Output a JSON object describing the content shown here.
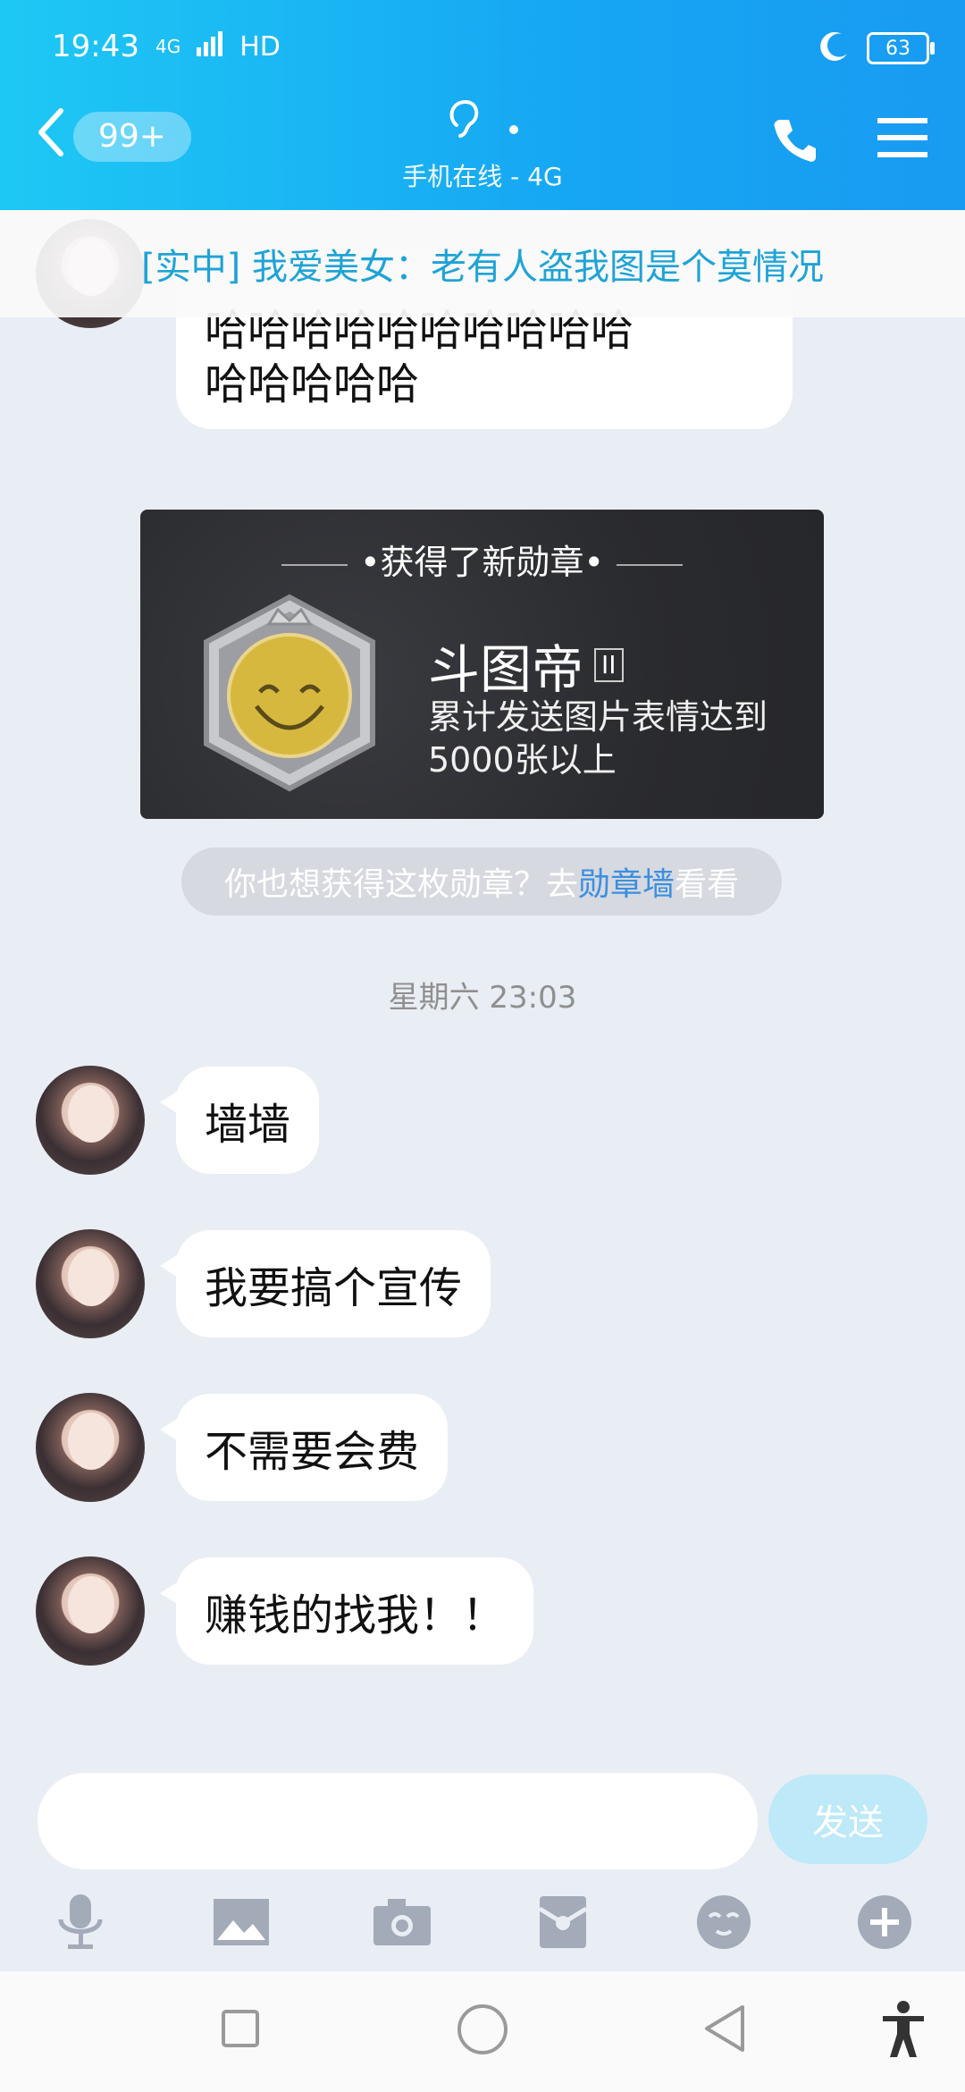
{
  "status": {
    "time": "19:43",
    "network": "4G",
    "hd": "HD",
    "battery": "63"
  },
  "header": {
    "unread": "99+",
    "sub": "手机在线 - 4G"
  },
  "notice": "[实中] 我爱美女：老有人盗我图是个莫情况",
  "first_message": {
    "line1": "哈哈哈哈哈哈哈哈哈哈哈哈哈哈哈哈哈哈哈哈",
    "line2": "哈哈哈哈哈哈哈哈哈哈",
    "line3": "哈哈哈哈哈"
  },
  "medal": {
    "heading": "获得了新勋章",
    "name": "斗图帝",
    "tier": "II",
    "desc": "累计发送图片表情达到5000张以上",
    "prompt_before": "你也想获得这枚勋章？去",
    "prompt_link": "勋章墙",
    "prompt_after": "看看"
  },
  "timestamp": "星期六 23:03",
  "messages": [
    "墙墙",
    "我要搞个宣传",
    "不需要会费",
    "赚钱的找我！！"
  ],
  "input": {
    "send": "发送",
    "placeholder": ""
  },
  "colors": {
    "header_start": "#1ec8f4",
    "header_end": "#189bf2",
    "notice_text": "#1ea3d6",
    "link": "#3b8fe0"
  }
}
